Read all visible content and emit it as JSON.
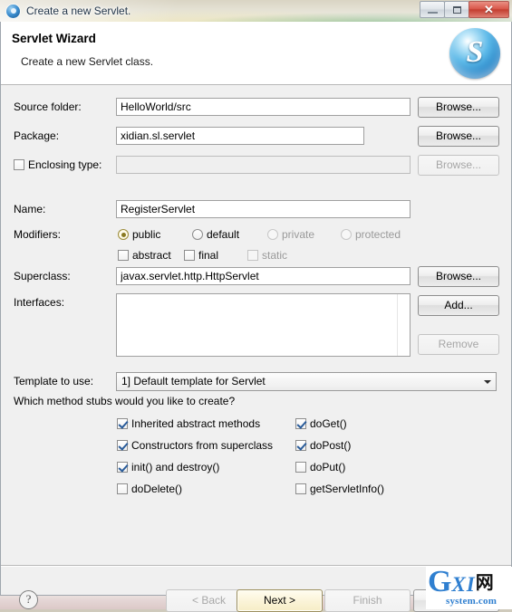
{
  "window": {
    "title": "Create a new Servlet.",
    "icon": "servlet-circle-icon",
    "controls": {
      "minimize": "minimize-icon",
      "maximize": "maximize-icon",
      "close": "✕"
    }
  },
  "header": {
    "title": "Servlet Wizard",
    "description": "Create a new Servlet class.",
    "logo_letter": "S"
  },
  "form": {
    "source_folder": {
      "label": "Source folder:",
      "value": "HelloWorld/src",
      "browse_label": "Browse..."
    },
    "package": {
      "label": "Package:",
      "value": "xidian.sl.servlet",
      "browse_label": "Browse..."
    },
    "enclosing_type": {
      "label": "Enclosing type:",
      "value": "",
      "checked": false,
      "browse_label": "Browse..."
    },
    "name": {
      "label": "Name:",
      "value": "RegisterServlet"
    },
    "modifiers": {
      "label": "Modifiers:",
      "radios": [
        {
          "label": "public",
          "selected": true,
          "enabled": true
        },
        {
          "label": "default",
          "selected": false,
          "enabled": true
        },
        {
          "label": "private",
          "selected": false,
          "enabled": false
        },
        {
          "label": "protected",
          "selected": false,
          "enabled": false
        }
      ],
      "checks": [
        {
          "label": "abstract",
          "checked": false,
          "enabled": true
        },
        {
          "label": "final",
          "checked": false,
          "enabled": true
        },
        {
          "label": "static",
          "checked": false,
          "enabled": false
        }
      ]
    },
    "superclass": {
      "label": "Superclass:",
      "value": "javax.servlet.http.HttpServlet",
      "browse_label": "Browse..."
    },
    "interfaces": {
      "label": "Interfaces:",
      "items": [],
      "add_label": "Add...",
      "remove_label": "Remove"
    },
    "template": {
      "label": "Template to use:",
      "value": "1] Default template for Servlet"
    },
    "stubs": {
      "question": "Which method stubs would you like to create?",
      "left_column": [
        {
          "label": "Inherited abstract methods",
          "checked": true
        },
        {
          "label": "Constructors from superclass",
          "checked": true
        },
        {
          "label": "init() and destroy()",
          "checked": true
        },
        {
          "label": "doDelete()",
          "checked": false
        }
      ],
      "right_column": [
        {
          "label": "doGet()",
          "checked": true
        },
        {
          "label": "doPost()",
          "checked": true
        },
        {
          "label": "doPut()",
          "checked": false
        },
        {
          "label": "getServletInfo()",
          "checked": false
        }
      ]
    }
  },
  "footer": {
    "help_glyph": "?",
    "back_label": "< Back",
    "next_label": "Next >",
    "finish_label": "Finish"
  },
  "watermark": {
    "g": "G",
    "xi": "XI",
    "cn": "网",
    "sub": "system.com"
  },
  "colors": {
    "accent": "#2f7fd0",
    "close_button": "#c33f31",
    "focus_button": "#f6edc6",
    "dialog_bg": "#f0f0f0"
  }
}
